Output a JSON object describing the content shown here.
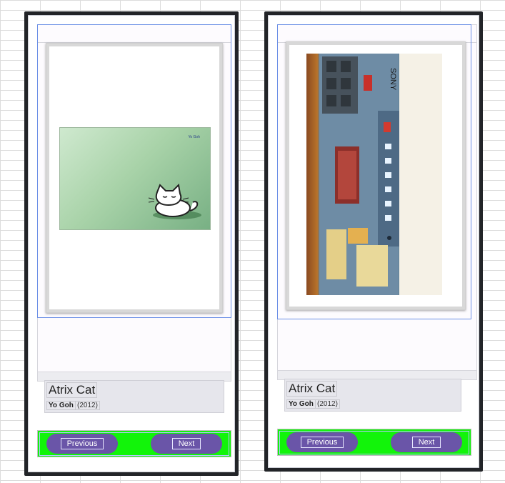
{
  "screens": [
    {
      "item_title": "Atrix Cat",
      "author": "Yo Goh",
      "year": "(2012)",
      "image_text": "Yo Goh",
      "prev_label": "Previous",
      "next_label": "Next"
    },
    {
      "item_title": "Atrix Cat",
      "author": "Yo Goh",
      "year": "(2012)",
      "prev_label": "Previous",
      "next_label": "Next"
    }
  ],
  "colors": {
    "nav_bar": "#12f40a",
    "button": "#6a55a8",
    "device_bezel": "#222428",
    "selection_outline": "#6b8fe6"
  }
}
